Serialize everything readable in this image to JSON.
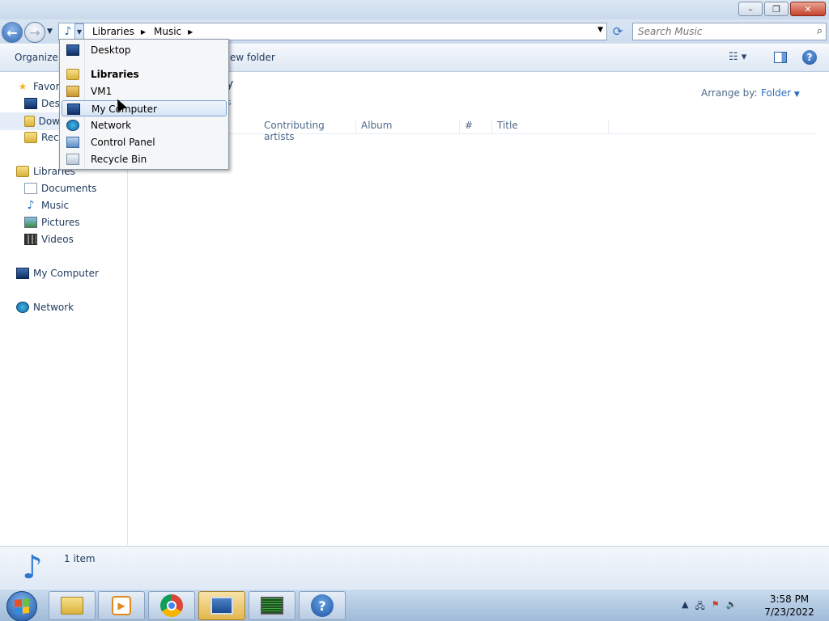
{
  "window": {
    "controls": {
      "minimize": "–",
      "maximize": "❐",
      "close": "✕"
    }
  },
  "address": {
    "breadcrumbs": [
      "Libraries",
      "Music"
    ],
    "search_placeholder": "Search Music"
  },
  "toolbar": {
    "organize_label": "Organize",
    "new_folder_label": "New folder",
    "visible_new_folder": "ew folder"
  },
  "nav": {
    "favorites_label": "Favori",
    "favorites_items": [
      "Desk",
      "Dow",
      "Rece"
    ],
    "libraries_label": "Libraries",
    "library_items": [
      "Documents",
      "Music",
      "Pictures",
      "Videos"
    ],
    "my_computer_label": "My Computer",
    "network_label": "Network"
  },
  "main": {
    "library_title_fragment": "y",
    "library_sub_fragment": "s",
    "arrange_label": "Arrange by:",
    "arrange_value": "Folder",
    "columns": [
      "Contributing artists",
      "Album",
      "#",
      "Title"
    ]
  },
  "details": {
    "item_count": "1 item"
  },
  "dropdown": {
    "items": [
      {
        "label": "Desktop",
        "icon": "desktop-icon",
        "bold": false
      },
      {
        "label": "Libraries",
        "icon": "libraries-folder-icon",
        "bold": true
      },
      {
        "label": "VM1",
        "icon": "user-folder-icon",
        "bold": false
      },
      {
        "label": "My Computer",
        "icon": "computer-icon",
        "bold": false,
        "highlighted": true
      },
      {
        "label": "Network",
        "icon": "network-icon",
        "bold": false
      },
      {
        "label": "Control Panel",
        "icon": "control-panel-icon",
        "bold": false
      },
      {
        "label": "Recycle Bin",
        "icon": "recycle-bin-icon",
        "bold": false
      }
    ]
  },
  "taskbar": {
    "apps": [
      "windows-explorer",
      "media-player",
      "chrome",
      "computer",
      "resource-monitor",
      "help"
    ],
    "clock_time": "3:58 PM",
    "clock_date": "7/23/2022"
  },
  "colors": {
    "accent": "#2b6fc2",
    "text": "#1e395b",
    "close_button": "#c6432c"
  }
}
